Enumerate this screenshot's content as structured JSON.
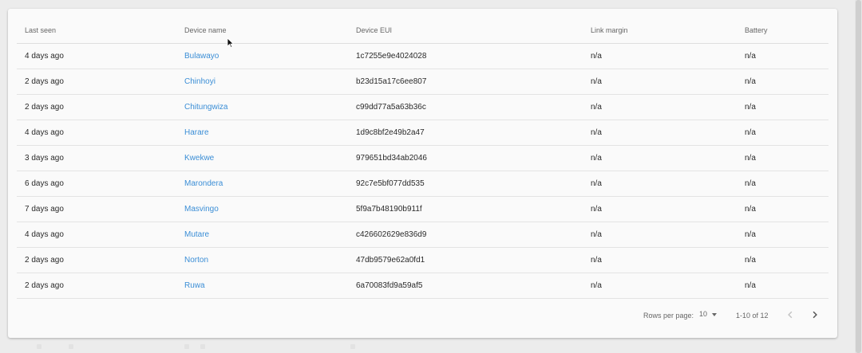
{
  "table": {
    "headers": [
      "Last seen",
      "Device name",
      "Device EUI",
      "Link margin",
      "Battery"
    ],
    "rows": [
      {
        "last_seen": "4 days ago",
        "name": "Bulawayo",
        "eui": "1c7255e9e4024028",
        "link_margin": "n/a",
        "battery": "n/a"
      },
      {
        "last_seen": "2 days ago",
        "name": "Chinhoyi",
        "eui": "b23d15a17c6ee807",
        "link_margin": "n/a",
        "battery": "n/a"
      },
      {
        "last_seen": "2 days ago",
        "name": "Chitungwiza",
        "eui": "c99dd77a5a63b36c",
        "link_margin": "n/a",
        "battery": "n/a"
      },
      {
        "last_seen": "4 days ago",
        "name": "Harare",
        "eui": "1d9c8bf2e49b2a47",
        "link_margin": "n/a",
        "battery": "n/a"
      },
      {
        "last_seen": "3 days ago",
        "name": "Kwekwe",
        "eui": "979651bd34ab2046",
        "link_margin": "n/a",
        "battery": "n/a"
      },
      {
        "last_seen": "6 days ago",
        "name": "Marondera",
        "eui": "92c7e5bf077dd535",
        "link_margin": "n/a",
        "battery": "n/a"
      },
      {
        "last_seen": "7 days ago",
        "name": "Masvingo",
        "eui": "5f9a7b48190b911f",
        "link_margin": "n/a",
        "battery": "n/a"
      },
      {
        "last_seen": "4 days ago",
        "name": "Mutare",
        "eui": "c426602629e836d9",
        "link_margin": "n/a",
        "battery": "n/a"
      },
      {
        "last_seen": "2 days ago",
        "name": "Norton",
        "eui": "47db9579e62a0fd1",
        "link_margin": "n/a",
        "battery": "n/a"
      },
      {
        "last_seen": "2 days ago",
        "name": "Ruwa",
        "eui": "6a70083fd9a59af5",
        "link_margin": "n/a",
        "battery": "n/a"
      }
    ]
  },
  "pagination": {
    "rows_per_page_label": "Rows per page:",
    "rows_per_page_value": "10",
    "range_text": "1-10 of 12",
    "prev_icon": "chevron-left-icon",
    "next_icon": "chevron-right-icon"
  },
  "colors": {
    "link": "#3b8ed6",
    "card_background": "#fafafa",
    "page_background": "#ececec"
  }
}
